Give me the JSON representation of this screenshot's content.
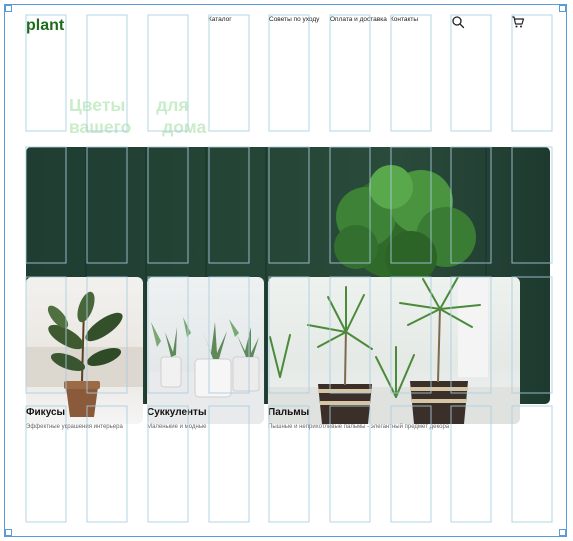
{
  "header": {
    "logo": "plant",
    "nav": [
      "Каталог",
      "Советы по уходу",
      "Оплата и доставка",
      "Контакты"
    ]
  },
  "hero": {
    "title": "Цветы для вашего дома"
  },
  "cards": [
    {
      "title": "Фикусы",
      "description": "Эффектные украшения интерьера"
    },
    {
      "title": "Суккуленты",
      "description": "Маленькие и модные"
    },
    {
      "title": "Пальмы",
      "description": "Пышные и неприхотливые пальмы - элегантный предмет декора"
    }
  ],
  "icons": [
    "search-icon",
    "cart-icon"
  ],
  "colors": {
    "logo": "#1e6b1e",
    "hero_title": "#c9ecc9",
    "hero_bg": "#254636",
    "grid": "#a9cde0"
  }
}
